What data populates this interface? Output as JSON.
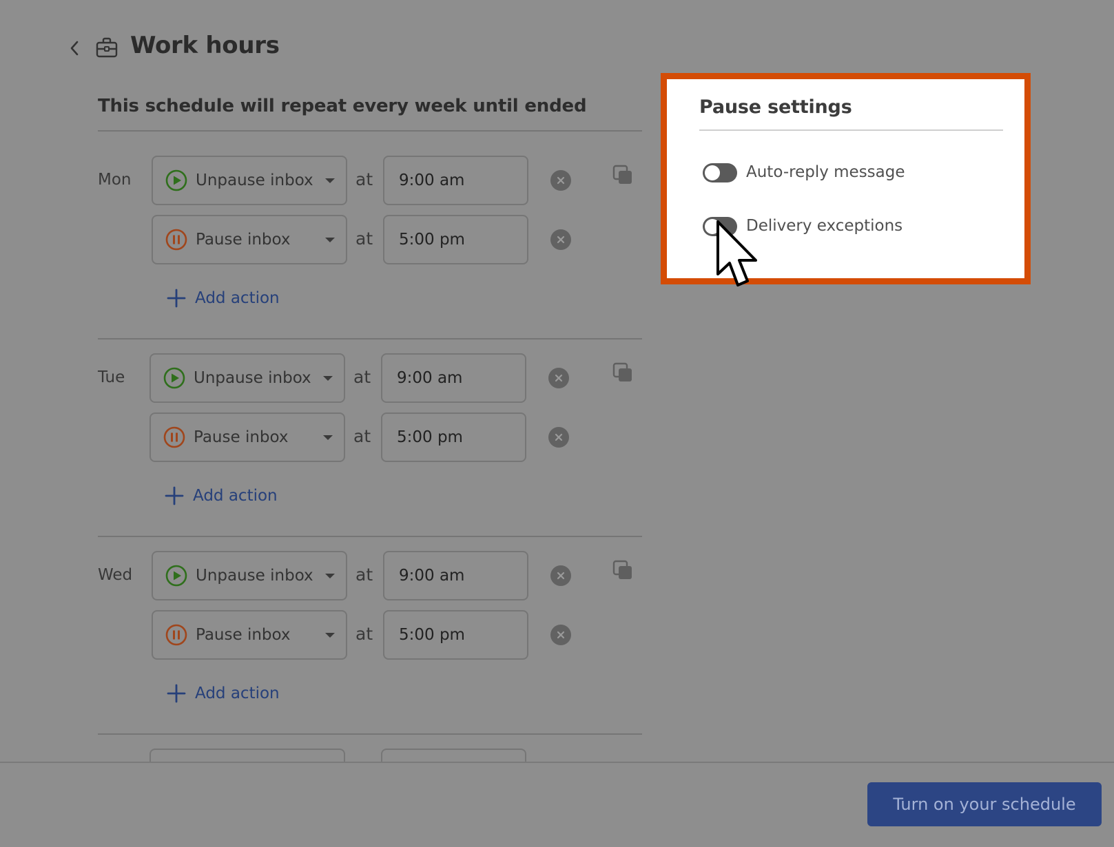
{
  "header": {
    "back_icon": "chevron-left-icon",
    "section_icon": "briefcase-icon",
    "title": "Work hours"
  },
  "schedule": {
    "subtitle": "This schedule will repeat every week until ended",
    "add_action_label": "Add action",
    "at_label": "at",
    "days": [
      {
        "day": "Mon",
        "actions": [
          {
            "action": "Unpause inbox",
            "icon": "play-circle-icon",
            "time": "9:00 am"
          },
          {
            "action": "Pause inbox",
            "icon": "pause-circle-icon",
            "time": "5:00 pm"
          }
        ]
      },
      {
        "day": "Tue",
        "actions": [
          {
            "action": "Unpause inbox",
            "icon": "play-circle-icon",
            "time": "9:00 am"
          },
          {
            "action": "Pause inbox",
            "icon": "pause-circle-icon",
            "time": "5:00 pm"
          }
        ]
      },
      {
        "day": "Wed",
        "actions": [
          {
            "action": "Unpause inbox",
            "icon": "play-circle-icon",
            "time": "9:00 am"
          },
          {
            "action": "Pause inbox",
            "icon": "pause-circle-icon",
            "time": "5:00 pm"
          }
        ]
      }
    ]
  },
  "pause_settings": {
    "title": "Pause settings",
    "toggles": [
      {
        "label": "Auto-reply message",
        "enabled": false
      },
      {
        "label": "Delivery exceptions",
        "enabled": false
      }
    ]
  },
  "footer": {
    "primary_button": "Turn on your schedule"
  },
  "colors": {
    "overlay_background": "#8e8e8e",
    "highlight_border": "#d44c06",
    "play_icon": "#2f6f1c",
    "pause_icon": "#a0461c",
    "link": "#26407a",
    "primary_button": "#2c4584"
  }
}
